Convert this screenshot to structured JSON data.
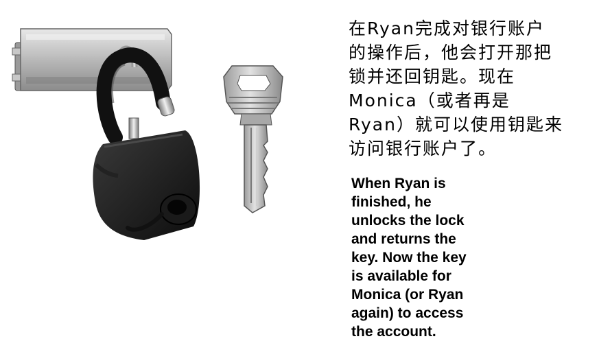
{
  "caption_zh": {
    "lines": [
      "在Ryan完成对银行账户",
      "的操作后，他会打开那把",
      "锁并还回钥匙。现在",
      "Monica（或者再是",
      "Ryan）就可以使用钥匙来",
      "访问银行账户了。"
    ]
  },
  "caption_en": {
    "lines": [
      "When Ryan is",
      "finished, he",
      "unlocks the lock",
      "and returns the",
      "key. Now the key",
      "is available for",
      "Monica (or Ryan",
      "again) to access",
      "the account."
    ]
  },
  "illustration": {
    "objects": [
      "hasp",
      "padlock",
      "key"
    ]
  }
}
